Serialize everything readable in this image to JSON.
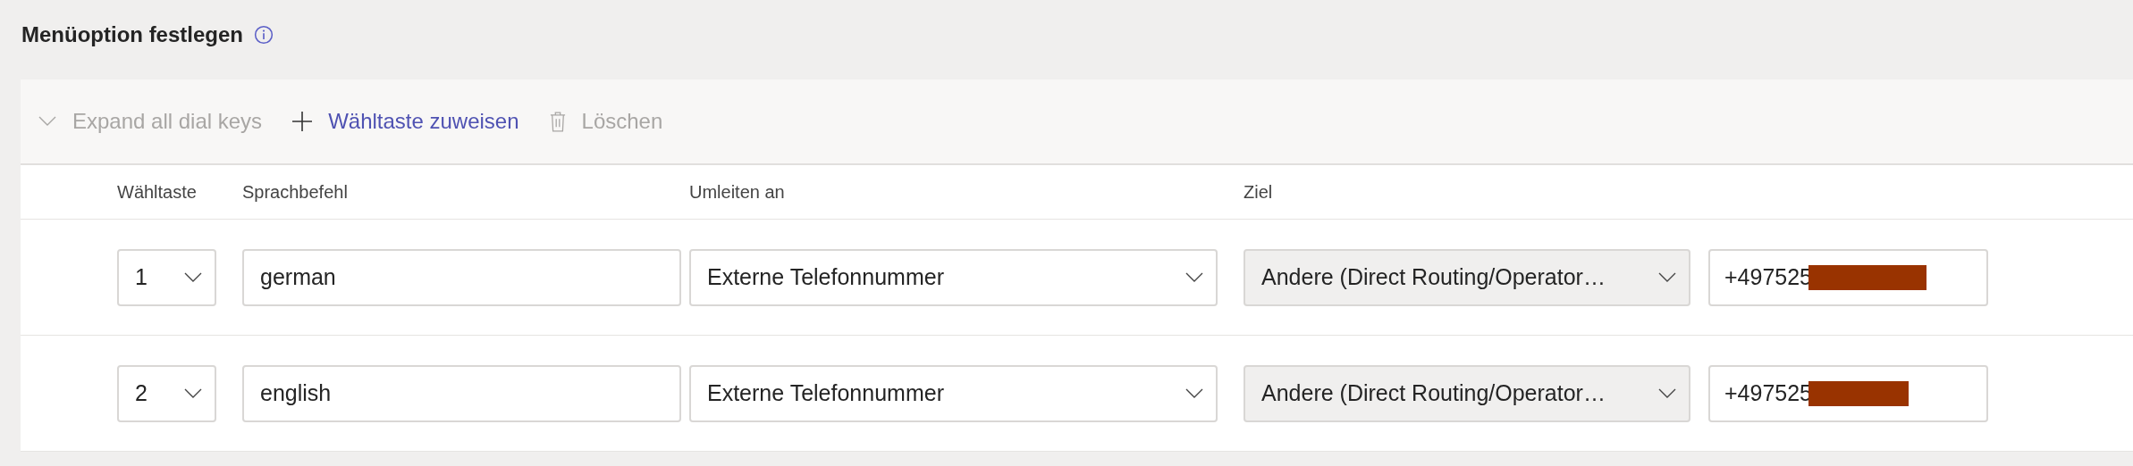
{
  "section": {
    "title": "Menüoption festlegen"
  },
  "toolbar": [
    {
      "kind": "expand",
      "label": "Expand all dial keys",
      "disabled": true
    },
    {
      "kind": "add",
      "label": "Wähltaste zuweisen",
      "disabled": false
    },
    {
      "kind": "delete",
      "label": "Löschen",
      "disabled": true
    }
  ],
  "columns": [
    "Wähltaste",
    "Sprachbefehl",
    "Umleiten an",
    "Ziel"
  ],
  "rows": [
    {
      "dial_key": "1",
      "voice_command": "german",
      "redirect_to": "Externe Telefonnummer",
      "target": {
        "value": "Andere (Direct Routing/Operator…",
        "disabled": true
      },
      "phone": "+497525"
    },
    {
      "dial_key": "2",
      "voice_command": "english",
      "redirect_to": "Externe Telefonnummer",
      "target": {
        "value": "Andere (Direct Routing/Operator…",
        "disabled": true
      },
      "phone": "+497525"
    }
  ]
}
